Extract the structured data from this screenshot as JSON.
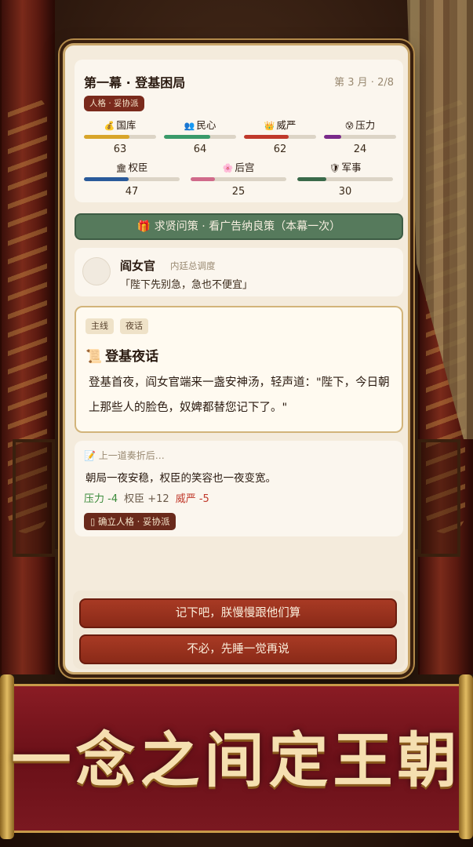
{
  "stage": {
    "title": "第一幕 · 登基困局",
    "progress": "第 3 月 · 2/8",
    "personality": "人格 · 妥协派"
  },
  "stats": [
    {
      "icon": "💰",
      "label": "国库",
      "value": "63",
      "pct": 63,
      "color": "#d8a52a"
    },
    {
      "icon": "👥",
      "label": "民心",
      "value": "64",
      "pct": 64,
      "color": "#3a9a6a"
    },
    {
      "icon": "👑",
      "label": "威严",
      "value": "62",
      "pct": 62,
      "color": "#c0392b"
    },
    {
      "icon": "😰",
      "label": "压力",
      "value": "24",
      "pct": 24,
      "color": "#7a2a8a"
    },
    {
      "icon": "🏛",
      "label": "权臣",
      "value": "47",
      "pct": 47,
      "color": "#2a5a9a"
    },
    {
      "icon": "🌸",
      "label": "后宫",
      "value": "25",
      "pct": 25,
      "color": "#d06a8a"
    },
    {
      "icon": "🛡",
      "label": "军事",
      "value": "30",
      "pct": 30,
      "color": "#3a6a4a"
    }
  ],
  "ad_button": {
    "icon": "🎁",
    "label": "求贤问策 · 看广告纳良策（本幕一次）"
  },
  "advisor": {
    "name": "阎女官",
    "role": "内廷总调度",
    "quote": "「陛下先别急，急也不便宜」"
  },
  "event": {
    "tags": [
      "主线",
      "夜话"
    ],
    "icon": "📜",
    "title": "登基夜话",
    "body": "登基首夜，阎女官端来一盏安神汤，轻声道：\"陛下，今日朝上那些人的脸色，奴婢都替您记下了。\""
  },
  "previous": {
    "heading": "📝 上一道奏折后…",
    "text": "朝局一夜安稳，权臣的笑容也一夜变宽。",
    "effects": [
      {
        "text": "压力 -4",
        "color": "#3a8a3a"
      },
      {
        "text": "权臣 +12",
        "color": "#6a5a4a"
      },
      {
        "text": "威严 -5",
        "color": "#c0392b"
      }
    ],
    "set_badge": "▯ 确立人格 · 妥协派"
  },
  "choices": [
    "记下吧，朕慢慢跟他们算",
    "不必，先睡一觉再说"
  ],
  "banner": {
    "text": "一念之间定王朝"
  }
}
